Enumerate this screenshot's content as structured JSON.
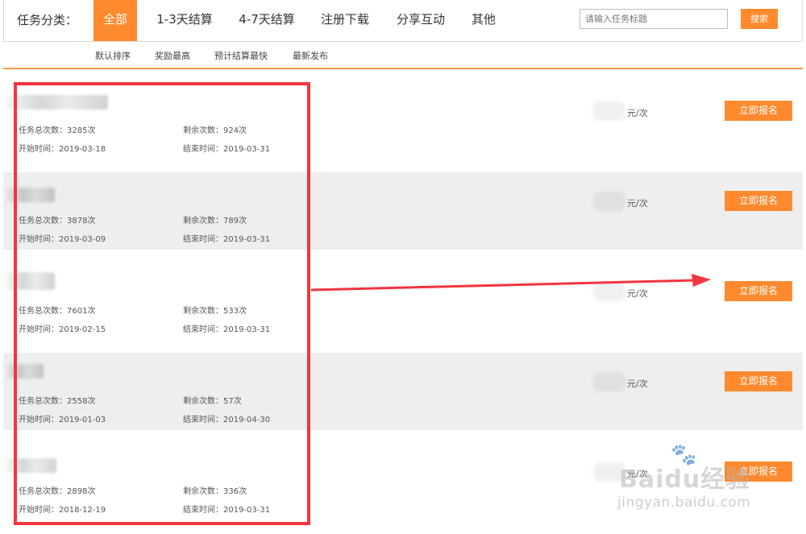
{
  "filter": {
    "category_label": "任务分类：",
    "tabs": [
      {
        "label": "全部",
        "active": true
      },
      {
        "label": "1-3天结算",
        "active": false
      },
      {
        "label": "4-7天结算",
        "active": false
      },
      {
        "label": "注册下载",
        "active": false
      },
      {
        "label": "分享互动",
        "active": false
      },
      {
        "label": "其他",
        "active": false
      }
    ],
    "search_placeholder": "请输入任务标题",
    "search_button": "搜索",
    "sort_options": [
      "默认排序",
      "奖励最高",
      "预计结算最快",
      "最新发布"
    ]
  },
  "tasks": [
    {
      "total": "任务总次数：3285次",
      "remaining": "剩余次数：924次",
      "start": "开始时间：2019-03-18",
      "end": "结束时间：2019-03-31",
      "unit": "元/次",
      "button": "立即报名"
    },
    {
      "total": "任务总次数：3878次",
      "remaining": "剩余次数：789次",
      "start": "开始时间：2019-03-09",
      "end": "结束时间：2019-03-31",
      "unit": "元/次",
      "button": "立即报名"
    },
    {
      "total": "任务总次数：7601次",
      "remaining": "剩余次数：533次",
      "start": "开始时间：2019-02-15",
      "end": "结束时间：2019-03-31",
      "unit": "元/次",
      "button": "立即报名"
    },
    {
      "total": "任务总次数：2558次",
      "remaining": "剩余次数：57次",
      "start": "开始时间：2019-01-03",
      "end": "结束时间：2019-04-30",
      "unit": "元/次",
      "button": "立即报名"
    },
    {
      "total": "任务总次数：2898次",
      "remaining": "剩余次数：336次",
      "start": "开始时间：2018-12-19",
      "end": "结束时间：2019-03-31",
      "unit": "元/次",
      "button": "立即报名"
    }
  ],
  "watermark": {
    "brand": "Baidu经验",
    "url": "jingyan.baidu.com"
  },
  "colors": {
    "accent": "#ff8a2e",
    "annotation": "#f2353f",
    "row_alt": "#eeeeee"
  }
}
